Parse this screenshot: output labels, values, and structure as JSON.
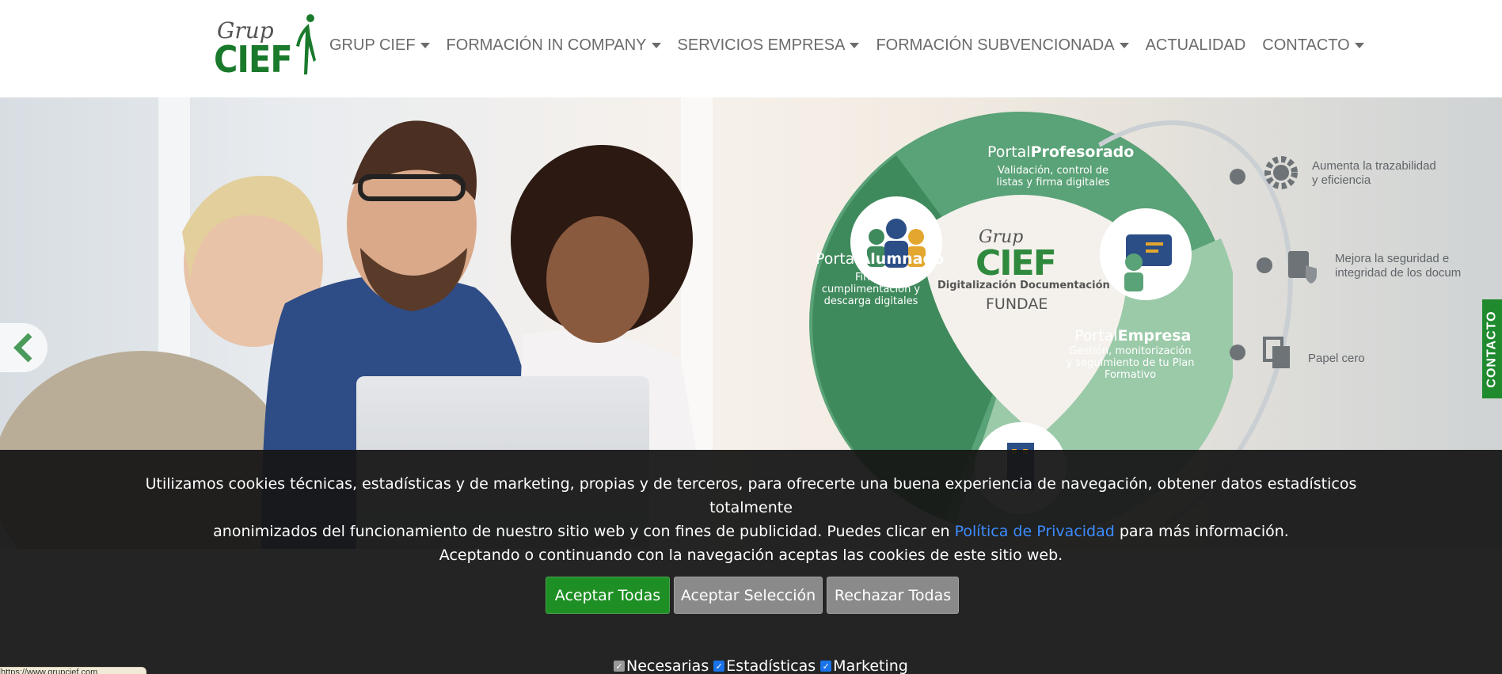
{
  "brand": {
    "logo_grup": "Grup",
    "logo_cief": "CIEF"
  },
  "nav": {
    "items": [
      {
        "label": "GRUP CIEF",
        "dropdown": true
      },
      {
        "label": "FORMACIÓN IN COMPANY",
        "dropdown": true
      },
      {
        "label": "SERVICIOS EMPRESA",
        "dropdown": true
      },
      {
        "label": "FORMACIÓN SUBVENCIONADA",
        "dropdown": true
      },
      {
        "label": "ACTUALIDAD",
        "dropdown": false
      },
      {
        "label": "CONTACTO",
        "dropdown": true
      }
    ]
  },
  "hero": {
    "portal_profesorado_prefix": "Portal",
    "portal_profesorado_name": "Profesorado",
    "portal_profesorado_desc1": "Validación, control de",
    "portal_profesorado_desc2": "listas y firma digitales",
    "portal_alumnado_prefix": "Portal",
    "portal_alumnado_name": "Alumnado",
    "portal_alumnado_desc1": "Firma,",
    "portal_alumnado_desc2": "cumplimentación y",
    "portal_alumnado_desc3": "descarga digitales",
    "portal_empresa_prefix": "Portal",
    "portal_empresa_name": "Empresa",
    "portal_empresa_desc1": "Gestión, monitorización",
    "portal_empresa_desc2": "y seguimiento de tu Plan",
    "portal_empresa_desc3": "Formativo",
    "center_grup": "Grup",
    "center_cief": "CIEF",
    "center_caption": "Digitalización Documentación",
    "center_fundae": "FUNDAE",
    "benefit1_line1": "Aumenta la trazabilidad",
    "benefit1_line2": "y eficiencia",
    "benefit2_line1": "Mejora la seguridad e",
    "benefit2_line2": "integridad de los docum",
    "benefit3": "Papel cero",
    "contact_tab": "CONTACTO",
    "colors": {
      "green_dark": "#3f8a5c",
      "green_mid": "#5aa277",
      "green_light": "#9bcaa9",
      "brand_green": "#1a7a2c"
    }
  },
  "cookie": {
    "text_line1": "Utilizamos cookies técnicas, estadísticas y de marketing, propias y de terceros, para ofrecerte una buena experiencia de navegación, obtener datos estadísticos totalmente",
    "text_line2_before": "anonimizados del funcionamiento de nuestro sitio web y con fines de publicidad. Puedes clicar en",
    "privacy_link": "Política de Privacidad",
    "text_line2_after": "para más información.",
    "text_line3": "Aceptando o continuando con la navegación aceptas las cookies de este sitio web.",
    "accept_all": "Aceptar Todas",
    "accept_selection": "Aceptar Selección",
    "reject_all": "Rechazar Todas",
    "check_necesarias": "Necesarias",
    "check_estadisticas": "Estadísticas",
    "check_marketing": "Marketing",
    "colors": {
      "accept": "#1e8f24",
      "secondary": "#8a8a8a",
      "link": "#3d8bff"
    }
  },
  "status_bar": {
    "url": "https://www.grupcief.com"
  }
}
